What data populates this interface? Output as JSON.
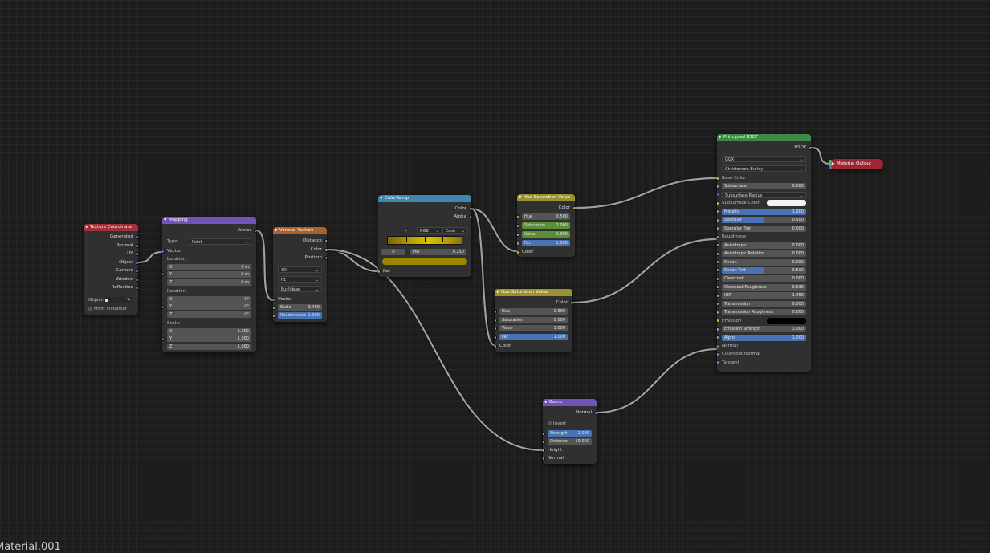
{
  "footer_label": "Material.001",
  "nodes": {
    "texcoord": {
      "title": "Texture Coordinate",
      "outputs": [
        "Generated",
        "Normal",
        "UV",
        "Object",
        "Camera",
        "Window",
        "Reflection"
      ],
      "object_label": "Object:",
      "from_instancer": "From Instancer"
    },
    "mapping": {
      "title": "Mapping",
      "output": "Vector",
      "type_label": "Type:",
      "type_value": "Point",
      "vector_label": "Vector",
      "location_label": "Location:",
      "location": [
        {
          "axis": "X",
          "value": "0 m"
        },
        {
          "axis": "Y",
          "value": "0 m"
        },
        {
          "axis": "Z",
          "value": "0 m"
        }
      ],
      "rotation_label": "Rotation:",
      "rotation": [
        {
          "axis": "X",
          "value": "0°"
        },
        {
          "axis": "Y",
          "value": "0°"
        },
        {
          "axis": "Z",
          "value": "0°"
        }
      ],
      "scale_label": "Scale:",
      "scale": [
        {
          "axis": "X",
          "value": "1.000"
        },
        {
          "axis": "Y",
          "value": "1.000"
        },
        {
          "axis": "Z",
          "value": "1.000"
        }
      ]
    },
    "voronoi": {
      "title": "Voronoi Texture",
      "outputs": [
        "Distance",
        "Color",
        "Position"
      ],
      "dims": "3D",
      "feature": "F1",
      "metric": "Euclidean",
      "vector_label": "Vector",
      "scale_label": "Scale",
      "scale_value": "3.400",
      "random_label": "Randomness",
      "random_value": "1.000"
    },
    "colorramp": {
      "title": "ColorRamp",
      "outputs": [
        "Color",
        "Alpha"
      ],
      "plus": "+",
      "minus": "−",
      "chev": "⌄",
      "mode": "RGB",
      "interp": "Ease",
      "index": "0",
      "pos_label": "Pos",
      "pos_value": "0.250",
      "fac_label": "Fac"
    },
    "hsv1": {
      "title": "Hue Saturation Value",
      "output": "Color",
      "hue_label": "Hue",
      "hue": "0.500",
      "sat_label": "Saturation",
      "sat": "1.000",
      "val_label": "Value",
      "val": "1.000",
      "fac_label": "Fac",
      "fac": "1.000",
      "color_label": "Color"
    },
    "hsv2": {
      "title": "Hue Saturation Value",
      "output": "Color",
      "hue_label": "Hue",
      "hue": "0.500",
      "sat_label": "Saturation",
      "sat": "0.000",
      "val_label": "Value",
      "val": "1.000",
      "fac_label": "Fac",
      "fac": "1.000",
      "color_label": "Color"
    },
    "bump": {
      "title": "Bump",
      "output": "Normal",
      "invert_label": "Invert",
      "strength_label": "Strength",
      "strength": "1.000",
      "distance_label": "Distance",
      "distance": "10.000",
      "height_label": "Height",
      "normal_label": "Normal"
    },
    "bsdf": {
      "title": "Principled BSDF",
      "output": "BSDF",
      "distribution": "GGX",
      "subsurface_method": "Christensen-Burley",
      "rows": [
        {
          "label": "Base Color",
          "kind": "socket",
          "sock": "sy"
        },
        {
          "label": "Subsurface",
          "kind": "field",
          "value": "0.000",
          "sock": "sg"
        },
        {
          "label": "Subsurface Radius",
          "kind": "dropdown",
          "sock": "sb"
        },
        {
          "label": "Subsurface Color",
          "kind": "color",
          "swatch": "#f2f2f2",
          "sock": "sy"
        },
        {
          "label": "Metallic",
          "kind": "field",
          "value": "1.000",
          "fill": 1.0,
          "sock": "sg"
        },
        {
          "label": "Specular",
          "kind": "field",
          "value": "0.500",
          "fill": 0.5,
          "sock": "sg"
        },
        {
          "label": "Specular Tint",
          "kind": "field",
          "value": "0.000",
          "sock": "sg"
        },
        {
          "label": "Roughness",
          "kind": "socket",
          "sock": "sg"
        },
        {
          "label": "Anisotropic",
          "kind": "field",
          "value": "0.000",
          "sock": "sg"
        },
        {
          "label": "Anisotropic Rotation",
          "kind": "field",
          "value": "0.000",
          "sock": "sg"
        },
        {
          "label": "Sheen",
          "kind": "field",
          "value": "0.000",
          "sock": "sg"
        },
        {
          "label": "Sheen Tint",
          "kind": "field",
          "value": "0.500",
          "fill": 0.5,
          "sock": "sg"
        },
        {
          "label": "Clearcoat",
          "kind": "field",
          "value": "0.000",
          "sock": "sg"
        },
        {
          "label": "Clearcoat Roughness",
          "kind": "field",
          "value": "0.030",
          "sock": "sg"
        },
        {
          "label": "IOR",
          "kind": "field",
          "value": "1.450",
          "sock": "sg"
        },
        {
          "label": "Transmission",
          "kind": "field",
          "value": "0.000",
          "sock": "sg"
        },
        {
          "label": "Transmission Roughness",
          "kind": "field",
          "value": "0.000",
          "sock": "sg"
        },
        {
          "label": "Emission",
          "kind": "color",
          "swatch": "#000000",
          "sock": "sy"
        },
        {
          "label": "Emission Strength",
          "kind": "field",
          "value": "1.000",
          "sock": "sg"
        },
        {
          "label": "Alpha",
          "kind": "field",
          "value": "1.000",
          "fill": 1.0,
          "sock": "sg"
        },
        {
          "label": "Normal",
          "kind": "socket",
          "sock": "sp"
        },
        {
          "label": "Clearcoat Normal",
          "kind": "socket",
          "sock": "sp"
        },
        {
          "label": "Tangent",
          "kind": "socket",
          "sock": "sp"
        }
      ]
    },
    "output": {
      "title": "Material Output"
    }
  },
  "colors": {
    "header_input": "#a1303b",
    "header_vector": "#6f55b8",
    "header_texture": "#a7622f",
    "header_converter": "#3e87b0",
    "header_color": "#9c9132",
    "header_shader": "#3f8a48",
    "header_output": "#9e2536",
    "wire": "#a0a0a0",
    "socket_color": "#c7c729",
    "socket_vector": "#6363c7",
    "socket_float": "#a1a1a1"
  }
}
